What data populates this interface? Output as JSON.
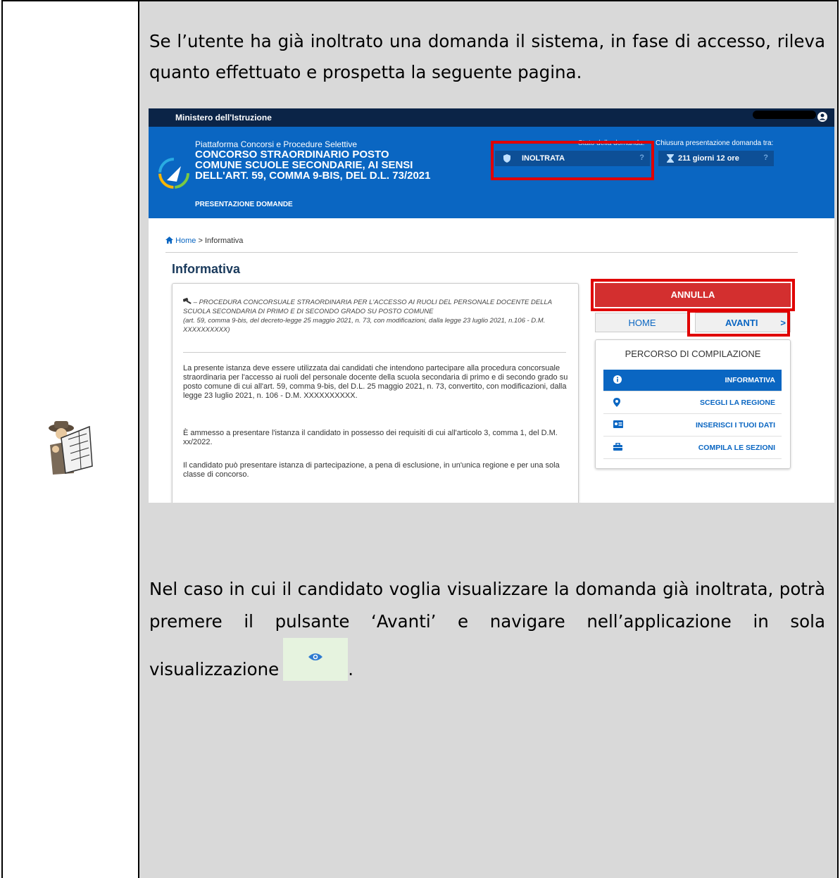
{
  "document": {
    "intro": "Se l’utente ha già inoltrato una domanda il sistema, in fase di accesso, rileva quanto effettuato e prospetta la seguente pagina.",
    "outro": "Nel caso in cui il candidato voglia visualizzare la domanda già inoltrata, potrà premere il pulsante ‘Avanti’ e navigare nell’applicazione in sola visualizzazione",
    "outro_end": "."
  },
  "screenshot": {
    "ministry": "Ministero dell'Istruzione",
    "platform": "Piattaforma Concorsi e Procedure Selettive",
    "title": "CONCORSO STRAORDINARIO POSTO COMUNE SCUOLE SECONDARIE, AI SENSI DELL'ART. 59, COMMA 9-BIS, DEL D.L. 73/2021",
    "subtitle": "PRESENTAZIONE DOMANDE",
    "stato_label": "Stato della domanda:",
    "chiusura_label": "Chiusura presentazione domanda tra:",
    "stato_value": "INOLTRATA",
    "chiusura_value": "211 giorni 12 ore",
    "question_mark": "?",
    "breadcrumb_home": "Home",
    "breadcrumb_sep": ">",
    "breadcrumb_current": "Informativa",
    "section_title": "Informativa",
    "procedure_heading": "– PROCEDURA CONCORSUALE STRAORDINARIA PER L'ACCESSO AI RUOLI DEL PERSONALE DOCENTE DELLA SCUOLA SECONDARIA DI PRIMO E DI SECONDO GRADO SU POSTO COMUNE",
    "procedure_ref": "(art. 59, comma 9-bis, del decreto-legge 25 maggio 2021, n. 73, con modificazioni, dalla legge 23 luglio 2021, n.106 - D.M. XXXXXXXXXX)",
    "para1": "La presente istanza deve essere utilizzata dai candidati che intendono partecipare alla procedura concorsuale straordinaria per l'accesso ai ruoli del personale docente della scuola secondaria di primo e di secondo grado su posto comune di cui all'art. 59, comma 9-bis, del D.L. 25 maggio 2021, n. 73, convertito, con modificazioni, dalla legge 23 luglio 2021, n. 106 - D.M. XXXXXXXXXX.",
    "para2": "È ammesso a presentare l'istanza il candidato in possesso dei requisiti di cui all'articolo 3, comma 1, del D.M. xx/2022.",
    "para3": "Il candidato può presentare istanza di partecipazione, a pena di esclusione, in un'unica regione e per una sola classe di concorso.",
    "annulla": "ANNULLA",
    "home": "HOME",
    "avanti": "AVANTI",
    "avanti_chevron": ">",
    "percorso_title": "PERCORSO DI COMPILAZIONE",
    "percorso_items": [
      "INFORMATIVA",
      "SCEGLI LA REGIONE",
      "INSERISCI I TUOI DATI",
      "COMPILA LE SEZIONI"
    ]
  },
  "colors": {
    "table_bg": "#d9d9d9",
    "ministry_bar": "#0b2447",
    "hero_blue": "#0a66c2",
    "highlight_red": "#e00000",
    "annulla_red": "#d32f2f"
  },
  "icons": [
    "detective-clipart",
    "eye-icon",
    "user-icon",
    "shield-icon",
    "hourglass-icon",
    "home-icon",
    "hammer-icon",
    "info-icon",
    "map-pin-icon",
    "id-card-icon",
    "briefcase-icon"
  ]
}
